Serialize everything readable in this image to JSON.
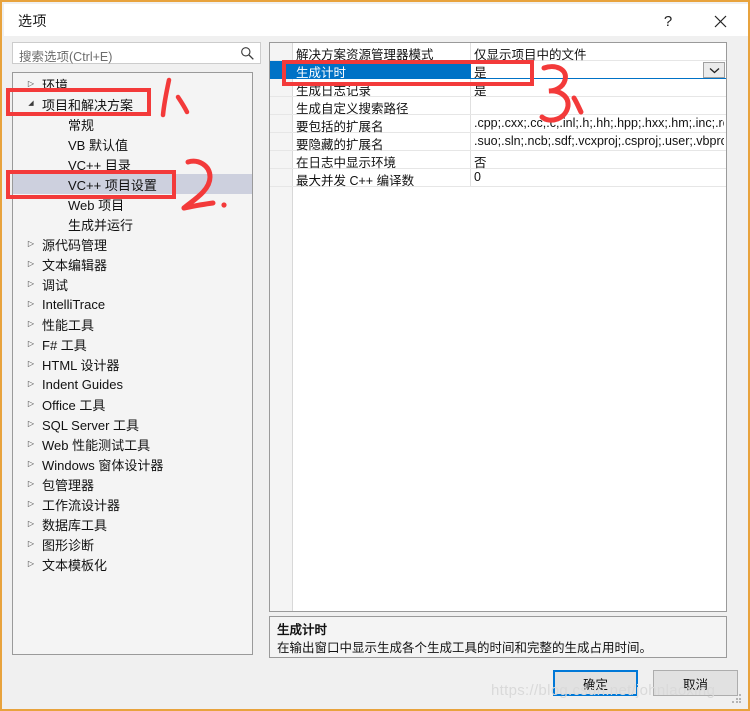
{
  "window": {
    "title": "选项",
    "help_label": "?",
    "close_label": "✕"
  },
  "search": {
    "placeholder": "搜索选项(Ctrl+E)",
    "icon": "search-icon"
  },
  "tree": {
    "items": [
      {
        "label": "环境",
        "indent": 0,
        "arrow": "▷",
        "state": "collapsed"
      },
      {
        "label": "项目和解决方案",
        "indent": 0,
        "arrow": "◢",
        "state": "expanded"
      },
      {
        "label": "常规",
        "indent": 1,
        "arrow": "",
        "state": "leaf"
      },
      {
        "label": "VB 默认值",
        "indent": 1,
        "arrow": "",
        "state": "leaf"
      },
      {
        "label": "VC++ 目录",
        "indent": 1,
        "arrow": "",
        "state": "leaf"
      },
      {
        "label": "VC++ 项目设置",
        "indent": 1,
        "arrow": "",
        "state": "selected"
      },
      {
        "label": "Web 项目",
        "indent": 1,
        "arrow": "",
        "state": "leaf"
      },
      {
        "label": "生成并运行",
        "indent": 1,
        "arrow": "",
        "state": "leaf"
      },
      {
        "label": "源代码管理",
        "indent": 0,
        "arrow": "▷",
        "state": "collapsed"
      },
      {
        "label": "文本编辑器",
        "indent": 0,
        "arrow": "▷",
        "state": "collapsed"
      },
      {
        "label": "调试",
        "indent": 0,
        "arrow": "▷",
        "state": "collapsed"
      },
      {
        "label": "IntelliTrace",
        "indent": 0,
        "arrow": "▷",
        "state": "collapsed"
      },
      {
        "label": "性能工具",
        "indent": 0,
        "arrow": "▷",
        "state": "collapsed"
      },
      {
        "label": "F# 工具",
        "indent": 0,
        "arrow": "▷",
        "state": "collapsed"
      },
      {
        "label": "HTML 设计器",
        "indent": 0,
        "arrow": "▷",
        "state": "collapsed"
      },
      {
        "label": "Indent Guides",
        "indent": 0,
        "arrow": "▷",
        "state": "collapsed"
      },
      {
        "label": "Office 工具",
        "indent": 0,
        "arrow": "▷",
        "state": "collapsed"
      },
      {
        "label": "SQL Server 工具",
        "indent": 0,
        "arrow": "▷",
        "state": "collapsed"
      },
      {
        "label": "Web 性能测试工具",
        "indent": 0,
        "arrow": "▷",
        "state": "collapsed"
      },
      {
        "label": "Windows 窗体设计器",
        "indent": 0,
        "arrow": "▷",
        "state": "collapsed"
      },
      {
        "label": "包管理器",
        "indent": 0,
        "arrow": "▷",
        "state": "collapsed"
      },
      {
        "label": "工作流设计器",
        "indent": 0,
        "arrow": "▷",
        "state": "collapsed"
      },
      {
        "label": "数据库工具",
        "indent": 0,
        "arrow": "▷",
        "state": "collapsed"
      },
      {
        "label": "图形诊断",
        "indent": 0,
        "arrow": "▷",
        "state": "collapsed"
      },
      {
        "label": "文本模板化",
        "indent": 0,
        "arrow": "▷",
        "state": "collapsed"
      }
    ]
  },
  "grid": {
    "rows": [
      {
        "name": "解决方案资源管理器模式",
        "value": "仅显示项目中的文件",
        "selected": false,
        "has_dropdown": false
      },
      {
        "name": "生成计时",
        "value": "是",
        "selected": true,
        "has_dropdown": true
      },
      {
        "name": "生成日志记录",
        "value": "是",
        "selected": false,
        "has_dropdown": false
      },
      {
        "name": "生成自定义搜索路径",
        "value": "",
        "selected": false,
        "has_dropdown": false
      },
      {
        "name": "要包括的扩展名",
        "value": ".cpp;.cxx;.cc;.c;.inl;.h;.hh;.hpp;.hxx;.hm;.inc;.rc;.r",
        "selected": false,
        "has_dropdown": false
      },
      {
        "name": "要隐藏的扩展名",
        "value": ".suo;.sln;.ncb;.sdf;.vcxproj;.csproj;.user;.vbproj",
        "selected": false,
        "has_dropdown": false
      },
      {
        "name": "在日志中显示环境",
        "value": "否",
        "selected": false,
        "has_dropdown": false
      },
      {
        "name": "最大并发 C++ 编译数",
        "value": "0",
        "selected": false,
        "has_dropdown": false
      }
    ]
  },
  "description": {
    "title": "生成计时",
    "body": "在输出窗口中显示生成各个生成工具的时间和完整的生成占用时间。"
  },
  "footer": {
    "ok_label": "确定",
    "cancel_label": "取消"
  },
  "annotations": {
    "marks": [
      "1.",
      "2.",
      "3."
    ],
    "color": "#f33a3a",
    "boxes": [
      "项目和解决方案",
      "VC++ 项目设置",
      "生成计时"
    ]
  },
  "watermark": {
    "text": "https://blog.csdn.net/johnlaoxing"
  },
  "colors": {
    "window_border": "#e8a33d",
    "selection_blue": "#0072c6",
    "tree_selection": "#cdd0de",
    "annotation_red": "#f33a3a",
    "primary_button_border": "#0078d7"
  }
}
